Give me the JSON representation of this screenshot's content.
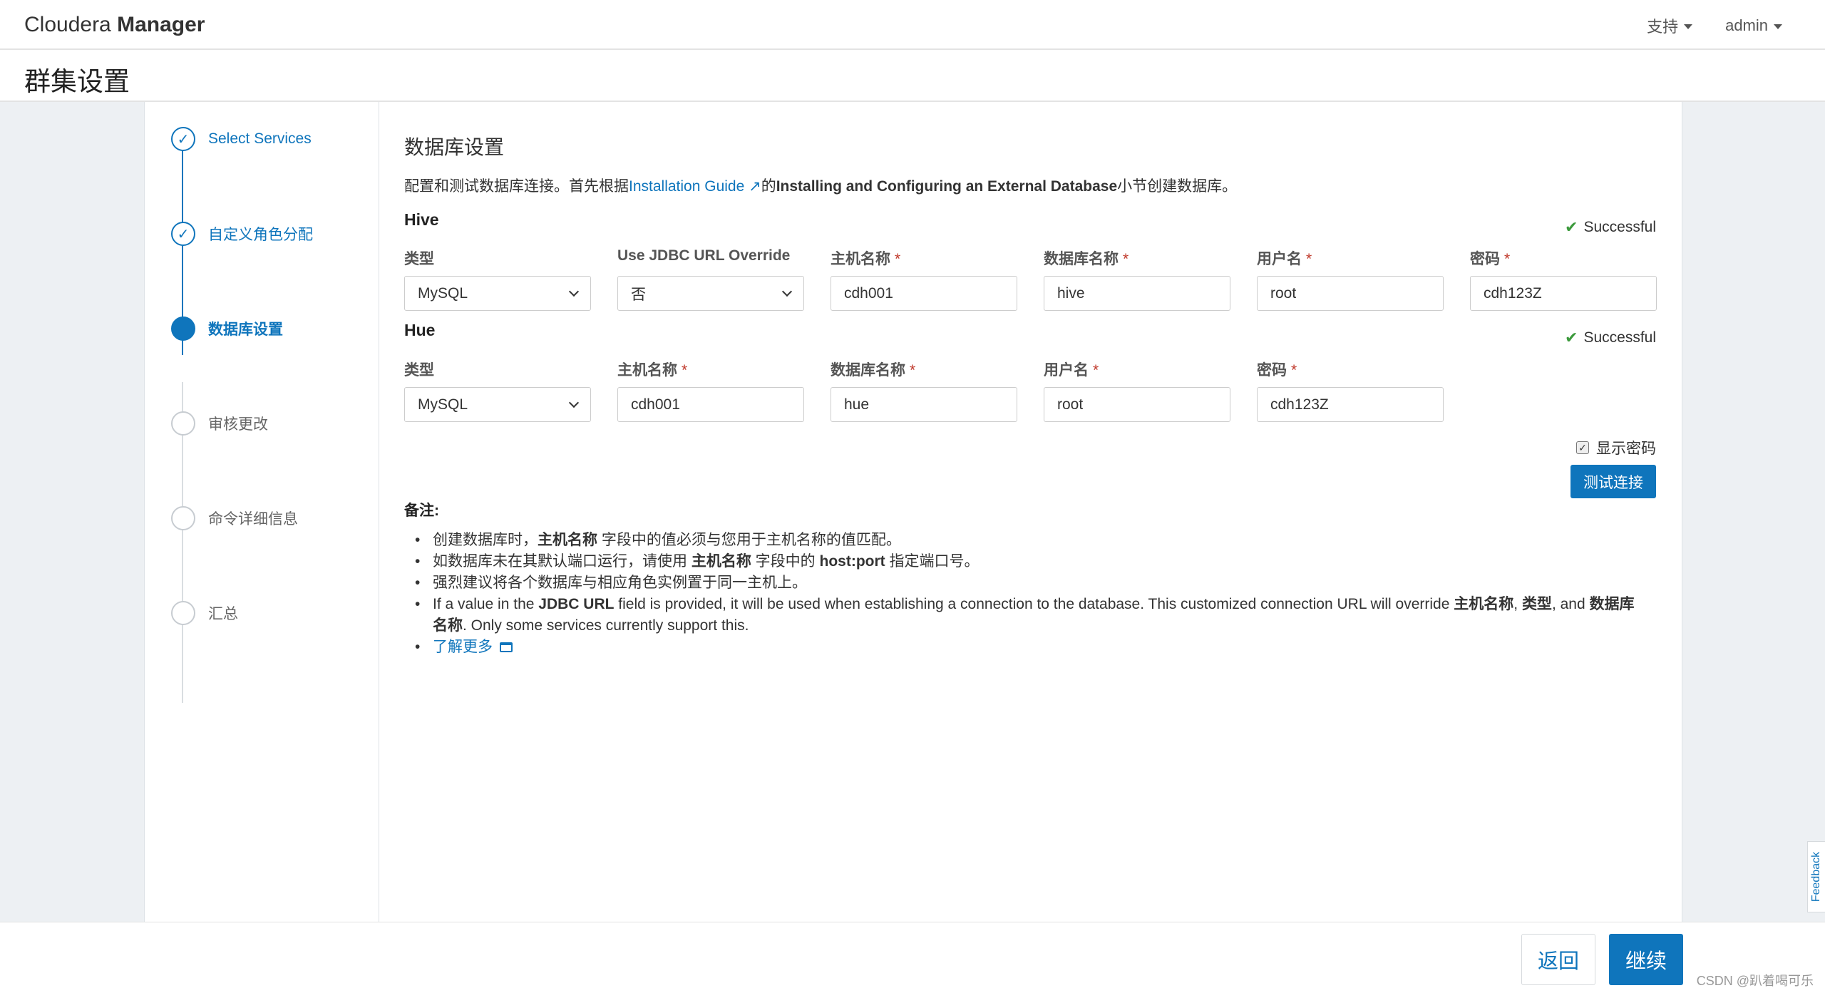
{
  "header": {
    "brand_light": "Cloudera",
    "brand_bold": "Manager",
    "support": "支持",
    "user": "admin"
  },
  "page": {
    "title": "群集设置"
  },
  "steps": [
    {
      "label": "Select Services",
      "state": "done"
    },
    {
      "label": "自定义角色分配",
      "state": "done"
    },
    {
      "label": "数据库设置",
      "state": "active"
    },
    {
      "label": "审核更改",
      "state": "pending"
    },
    {
      "label": "命令详细信息",
      "state": "pending"
    },
    {
      "label": "汇总",
      "state": "pending"
    }
  ],
  "main": {
    "section_title": "数据库设置",
    "intro_prefix": "配置和测试数据库连接。首先根据",
    "intro_link": "Installation Guide",
    "intro_mid": "的",
    "intro_bold": "Installing and Configuring an External Database",
    "intro_suffix": "小节创建数据库。",
    "hive": {
      "label": "Hive",
      "status": "Successful",
      "fields": {
        "type_label": "类型",
        "type_value": "MySQL",
        "jdbc_label": "Use JDBC URL Override",
        "jdbc_value": "否",
        "host_label": "主机名称",
        "host_value": "cdh001",
        "db_label": "数据库名称",
        "db_value": "hive",
        "user_label": "用户名",
        "user_value": "root",
        "pw_label": "密码",
        "pw_value": "cdh123Z"
      }
    },
    "hue": {
      "label": "Hue",
      "status": "Successful",
      "fields": {
        "type_label": "类型",
        "type_value": "MySQL",
        "host_label": "主机名称",
        "host_value": "cdh001",
        "db_label": "数据库名称",
        "db_value": "hue",
        "user_label": "用户名",
        "user_value": "root",
        "pw_label": "密码",
        "pw_value": "cdh123Z"
      }
    },
    "required_mark": "*",
    "show_password": "显示密码",
    "test_button": "测试连接",
    "notes_title": "备注:",
    "notes": {
      "n1_a": "创建数据库时，",
      "n1_b": "主机名称",
      "n1_c": " 字段中的值必须与您用于主机名称的值匹配。",
      "n2_a": "如数据库未在其默认端口运行，请使用 ",
      "n2_b": "主机名称",
      "n2_c": " 字段中的 ",
      "n2_d": "host:port",
      "n2_e": " 指定端口号。",
      "n3": "强烈建议将各个数据库与相应角色实例置于同一主机上。",
      "n4_a": "If a value in the ",
      "n4_b": "JDBC URL",
      "n4_c": " field is provided, it will be used when establishing a connection to the database. This customized connection URL will override ",
      "n4_d": "主机名称",
      "n4_e": ", ",
      "n4_f": "类型",
      "n4_g": ", and ",
      "n4_h": "数据库名称",
      "n4_i": ". Only some services currently support this.",
      "learn_more": "了解更多"
    }
  },
  "footer": {
    "back": "返回",
    "next": "继续",
    "watermark": "CSDN @趴着喝可乐"
  },
  "feedback": "Feedback",
  "colors": {
    "accent": "#0f75bc",
    "success": "#3c9a3c",
    "required": "#c0392b"
  }
}
